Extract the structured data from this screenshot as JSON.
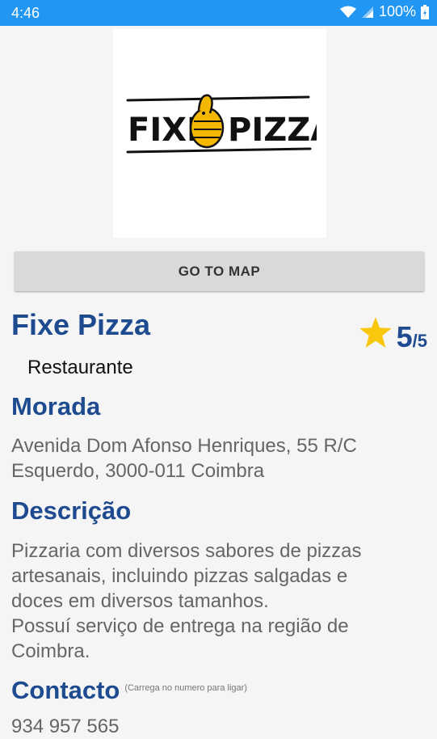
{
  "status_bar": {
    "time": "4:46",
    "battery": "100%",
    "wifi_icon": "wifi-icon",
    "signal_icon": "signal-icon",
    "battery_icon": "battery-icon"
  },
  "logo": {
    "text_left": "FIXE",
    "text_right": "PIZZA",
    "icon": "thumbs-up-pizza-icon",
    "accent": "#f5b800"
  },
  "map_button": {
    "label": "GO TO MAP"
  },
  "place": {
    "name": "Fixe Pizza",
    "category": "Restaurante"
  },
  "rating": {
    "value": "5",
    "max": "/5",
    "icon": "star-icon",
    "star_color": "#f9c80e"
  },
  "address": {
    "title": "Morada",
    "line1": "Avenida Dom Afonso Henriques, 55 R/C",
    "line2": "Esquerdo, 3000-011 Coimbra"
  },
  "description": {
    "title": "Descrição",
    "line1": "Pizzaria com diversos sabores de pizzas",
    "line2": "artesanais, incluindo pizzas salgadas e",
    "line3": "doces em diversos tamanhos.",
    "line4": "Possuí serviço de entrega na região de",
    "line5": "Coimbra."
  },
  "contact": {
    "title": "Contacto",
    "hint": "(Carrega no numero para ligar)",
    "phone": "934 957 565"
  },
  "colors": {
    "status_bar": "#2196f3",
    "heading": "#1e4b8f",
    "button_bg": "#d9d9d9"
  }
}
